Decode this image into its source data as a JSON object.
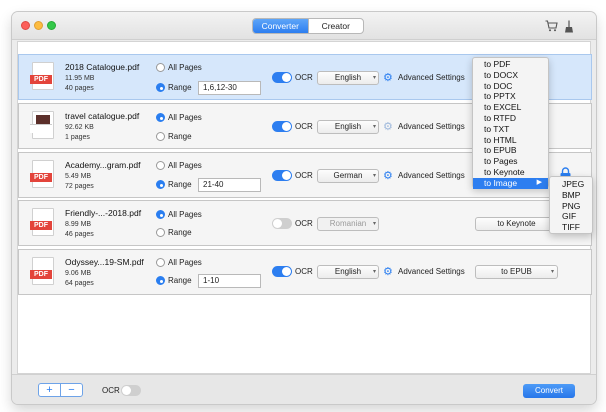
{
  "toolbar": {
    "tabs": [
      {
        "label": "Converter",
        "active": true
      },
      {
        "label": "Creator",
        "active": false
      }
    ],
    "icons": [
      "cart-icon",
      "broom-icon"
    ]
  },
  "files": [
    {
      "name": "2018 Catalogue.pdf",
      "size": "11.95 MB",
      "pages": "40 pages",
      "icon_tag": "PDF",
      "all_pages_label": "All Pages",
      "range_label": "Range",
      "range_selected": true,
      "range_value": "1,6,12-30",
      "ocr_label": "OCR",
      "ocr_on": true,
      "language": "English",
      "advanced_label": "Advanced Settings",
      "format": "",
      "selected": true
    },
    {
      "name": "travel catalogue.pdf",
      "size": "92.62 KB",
      "pages": "1 pages",
      "icon_tag": "",
      "all_pages_label": "All Pages",
      "range_label": "Range",
      "range_selected": false,
      "range_value": "",
      "ocr_label": "OCR",
      "ocr_on": true,
      "language": "English",
      "advanced_label": "Advanced Settings",
      "format": "",
      "selected": false
    },
    {
      "name": "Academy...gram.pdf",
      "size": "5.49 MB",
      "pages": "72 pages",
      "icon_tag": "PDF",
      "all_pages_label": "All Pages",
      "range_label": "Range",
      "range_selected": true,
      "range_value": "21-40",
      "ocr_label": "OCR",
      "ocr_on": true,
      "language": "German",
      "advanced_label": "Advanced Settings",
      "format": "",
      "selected": false
    },
    {
      "name": "Friendly-...-2018.pdf",
      "size": "8.99 MB",
      "pages": "46 pages",
      "icon_tag": "PDF",
      "all_pages_label": "All Pages",
      "range_label": "Range",
      "range_selected": false,
      "range_value": "",
      "ocr_label": "OCR",
      "ocr_on": false,
      "language": "Romanian",
      "advanced_label": "",
      "format": "to Keynote",
      "selected": false
    },
    {
      "name": "Odyssey...19-SM.pdf",
      "size": "9.06 MB",
      "pages": "64 pages",
      "icon_tag": "PDF",
      "all_pages_label": "All Pages",
      "range_label": "Range",
      "range_selected": true,
      "range_value": "1-10",
      "ocr_label": "OCR",
      "ocr_on": true,
      "language": "English",
      "advanced_label": "Advanced Settings",
      "format": "to EPUB",
      "selected": false
    }
  ],
  "format_menu": {
    "items": [
      "to PDF",
      "to DOCX",
      "to DOC",
      "to PPTX",
      "to EXCEL",
      "to RTFD",
      "to TXT",
      "to HTML",
      "to EPUB",
      "to Pages",
      "to Keynote",
      "to Image"
    ],
    "highlighted": "to Image",
    "image_submenu": [
      "JPEG",
      "BMP",
      "PNG",
      "GIF",
      "TIFF"
    ]
  },
  "bottom": {
    "add": "+",
    "remove": "−",
    "ocr_label": "OCR",
    "ocr_on": false,
    "convert_label": "Convert"
  },
  "colors": {
    "accent": "#2d7ef0",
    "pdf_red": "#e3443b",
    "selected_row": "#d6e7fb"
  }
}
